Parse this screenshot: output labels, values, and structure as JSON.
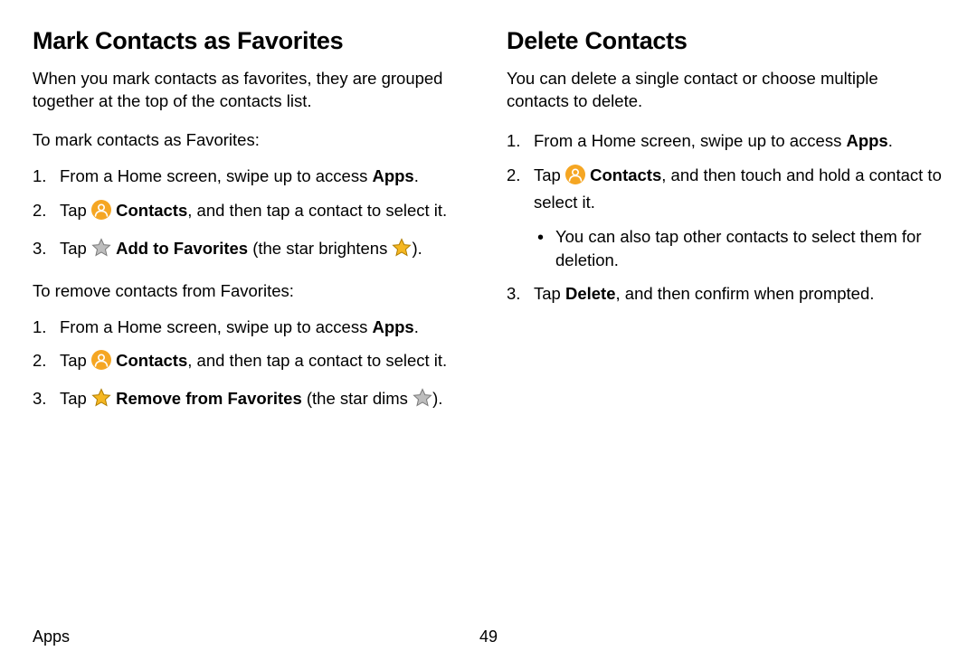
{
  "left": {
    "heading": "Mark Contacts as Favorites",
    "intro": "When you mark contacts as favorites, they are grouped together at the top of the contacts list.",
    "lead1": "To mark contacts as Favorites:",
    "step1_a": "From a Home screen, swipe up to access ",
    "step1_b": "Apps",
    "step1_c": ".",
    "step2_a": "Tap ",
    "step2_b": "Contacts",
    "step2_c": ", and then tap a contact to select it.",
    "step3_a": "Tap ",
    "step3_b": "Add to Favorites",
    "step3_c": " (the star brightens ",
    "step3_d": ").",
    "lead2": "To remove contacts from Favorites:",
    "r_step1_a": "From a Home screen, swipe up to access ",
    "r_step1_b": "Apps",
    "r_step1_c": ".",
    "r_step2_a": "Tap ",
    "r_step2_b": "Contacts",
    "r_step2_c": ", and then tap a contact to select it.",
    "r_step3_a": "Tap ",
    "r_step3_b": "Remove from Favorites",
    "r_step3_c": " (the star dims ",
    "r_step3_d": ")."
  },
  "right": {
    "heading": "Delete Contacts",
    "intro": "You can delete a single contact or choose multiple contacts to delete.",
    "step1_a": "From a Home screen, swipe up to access ",
    "step1_b": "Apps",
    "step1_c": ".",
    "step2_a": "Tap ",
    "step2_b": "Contacts",
    "step2_c": ", and then touch and hold a contact to select it.",
    "step2_sub": "You can also tap other contacts to select them for deletion.",
    "step3_a": "Tap ",
    "step3_b": "Delete",
    "step3_c": ", and then confirm when prompted."
  },
  "footer": {
    "section": "Apps",
    "page": "49"
  }
}
